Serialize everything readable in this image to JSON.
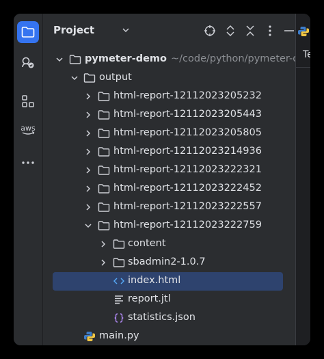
{
  "panel": {
    "title": "Project",
    "peek_tab": "Te"
  },
  "tree": {
    "root": {
      "name": "pymeter-demo",
      "path": "~/code/python/pymeter-demo"
    },
    "output": "output",
    "reports": [
      "html-report-12112023205232",
      "html-report-12112023205443",
      "html-report-12112023205805",
      "html-report-12112023214936",
      "html-report-12112023222321",
      "html-report-12112023222452",
      "html-report-12112023222557",
      "html-report-12112023222759"
    ],
    "expanded_children": {
      "content": "content",
      "sbadmin": "sbadmin2-1.0.7",
      "index": "index.html",
      "jtl": "report.jtl",
      "stats": "statistics.json"
    },
    "main": "main.py"
  },
  "colors": {
    "accent": "#3574f0",
    "selection": "#2e436e",
    "html_icon": "#56a8f5",
    "json_icon": "#b189f5"
  }
}
